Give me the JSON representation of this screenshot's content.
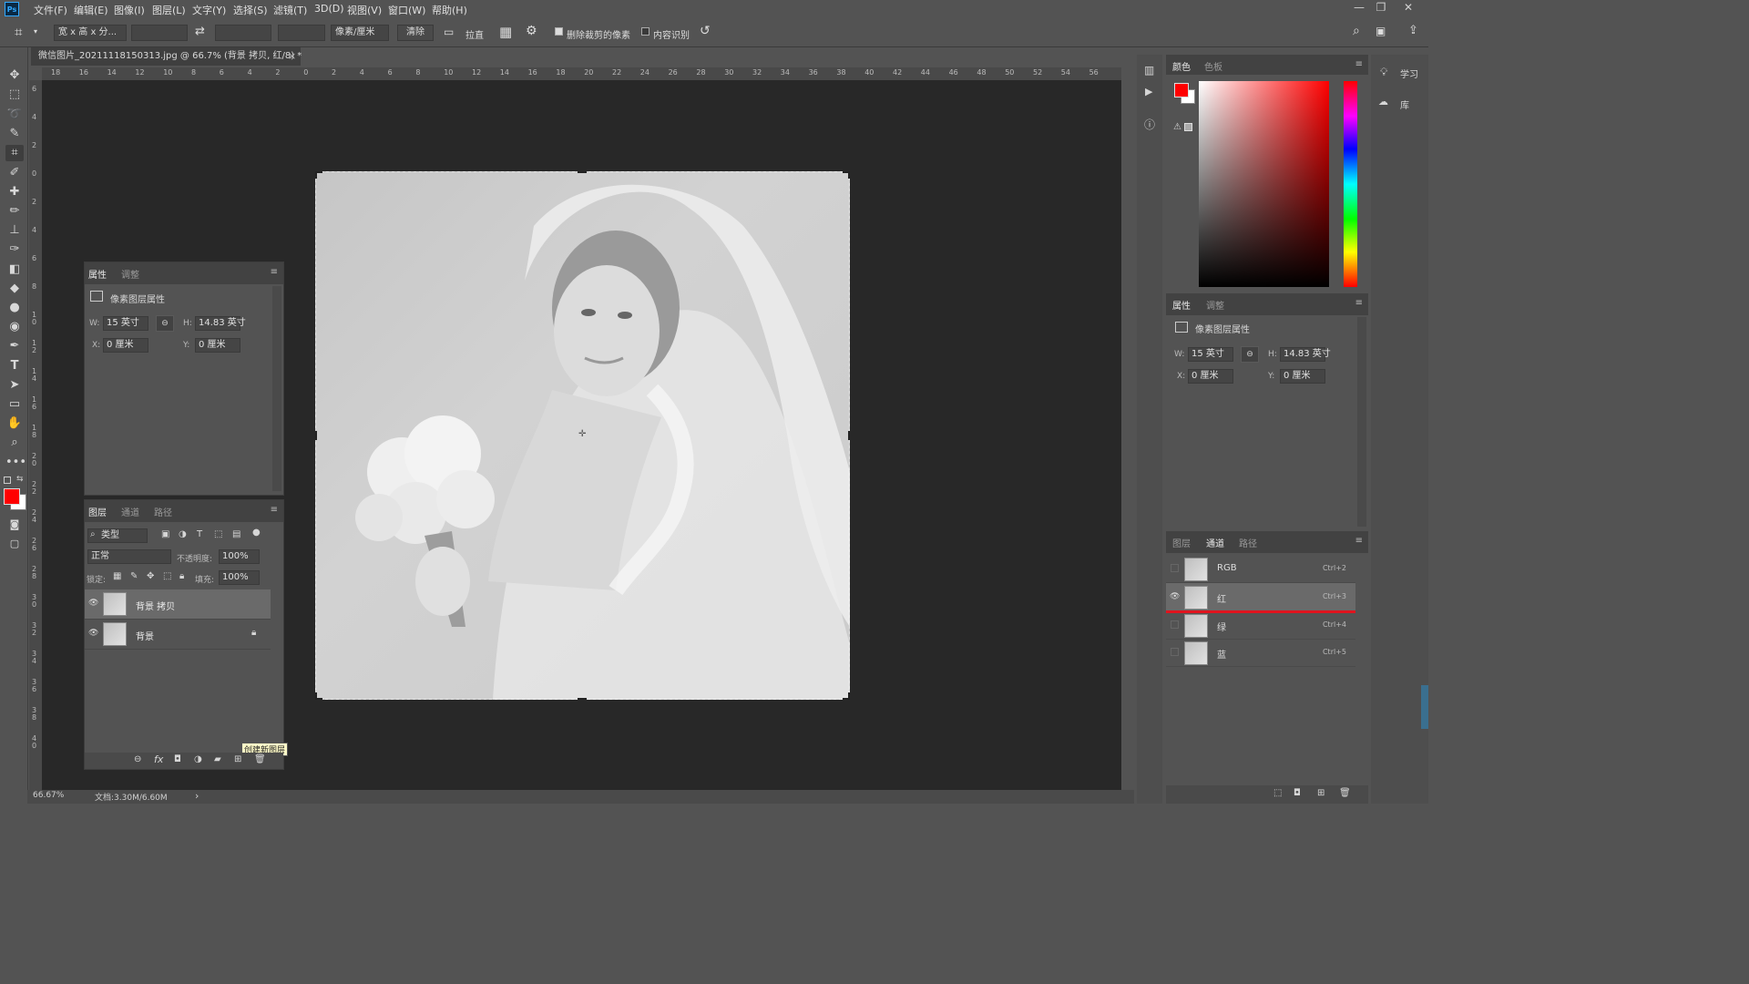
{
  "app": {
    "logo": "Ps"
  },
  "menu": [
    "文件(F)",
    "编辑(E)",
    "图像(I)",
    "图层(L)",
    "文字(Y)",
    "选择(S)",
    "滤镜(T)",
    "3D(D)",
    "视图(V)",
    "窗口(W)",
    "帮助(H)"
  ],
  "window_controls": {
    "minimize": "—",
    "restore": "❐",
    "close": "✕"
  },
  "options": {
    "ratio_select": "宽 x 高 x 分...",
    "swap_icon": "⇄",
    "units_select": "像素/厘米",
    "clear_button": "清除",
    "straighten_label": "拉直",
    "delete_cropped_label": "删除裁剪的像素",
    "delete_cropped_checked": true,
    "content_aware_label": "内容识别",
    "content_aware_checked": false
  },
  "document": {
    "tab_title": "微信图片_20211118150313.jpg @ 66.7% (背景 拷贝, 红/8) *",
    "close": "×",
    "ruler_h_labels": [
      "18",
      "16",
      "14",
      "12",
      "10",
      "8",
      "6",
      "4",
      "2",
      "0",
      "2",
      "4",
      "6",
      "8",
      "10",
      "12",
      "14",
      "16",
      "18",
      "20",
      "22",
      "24",
      "26",
      "28",
      "30",
      "32",
      "34",
      "36",
      "38",
      "40",
      "42",
      "44",
      "46",
      "48",
      "50",
      "52",
      "54",
      "56"
    ],
    "ruler_v_labels": [
      "6",
      "4",
      "2",
      "0",
      "2",
      "4",
      "6",
      "8",
      "1\n0",
      "1\n2",
      "1\n4",
      "1\n6",
      "1\n8",
      "2\n0",
      "2\n2",
      "2\n4",
      "2\n6",
      "2\n8",
      "3\n0",
      "3\n2",
      "3\n4",
      "3\n6",
      "3\n8",
      "4\n0"
    ]
  },
  "status": {
    "zoom": "66.67%",
    "doc_info": "文档:3.30M/6.60M",
    "arrow": "›"
  },
  "properties_float": {
    "tabs": [
      "属性",
      "调整"
    ],
    "title": "像素图层属性",
    "w_label": "W:",
    "w_value": "15 英寸",
    "h_label": "H:",
    "h_value": "14.83 英寸",
    "x_label": "X:",
    "x_value": "0 厘米",
    "y_label": "Y:",
    "y_value": "0 厘米"
  },
  "layers_float": {
    "tabs": [
      "图层",
      "通道",
      "路径"
    ],
    "filter_kind": "类型",
    "blend_mode": "正常",
    "opacity_label": "不透明度:",
    "opacity_value": "100%",
    "lock_label": "锁定:",
    "fill_label": "填充:",
    "fill_value": "100%",
    "layers": [
      {
        "name": "背景 拷贝"
      },
      {
        "name": "背景"
      }
    ],
    "tooltip": "创建新图层"
  },
  "color_panel": {
    "tabs": [
      "颜色",
      "色板"
    ],
    "foreground": "#ff0000",
    "background": "#ffffff"
  },
  "properties_right": {
    "tabs": [
      "属性",
      "调整"
    ],
    "title": "像素图层属性",
    "w_label": "W:",
    "w_value": "15 英寸",
    "h_label": "H:",
    "h_value": "14.83 英寸",
    "x_label": "X:",
    "x_value": "0 厘米",
    "y_label": "Y:",
    "y_value": "0 厘米"
  },
  "channels_panel": {
    "tabs": [
      "图层",
      "通道",
      "路径"
    ],
    "channels": [
      {
        "name": "RGB",
        "shortcut": "Ctrl+2"
      },
      {
        "name": "红",
        "shortcut": "Ctrl+3"
      },
      {
        "name": "绿",
        "shortcut": "Ctrl+4"
      },
      {
        "name": "蓝",
        "shortcut": "Ctrl+5"
      }
    ]
  },
  "far_right": {
    "learn": "学习",
    "library": "库"
  },
  "colors": {
    "accent_red": "#e0141e",
    "highlight": "#6a6a6a"
  }
}
